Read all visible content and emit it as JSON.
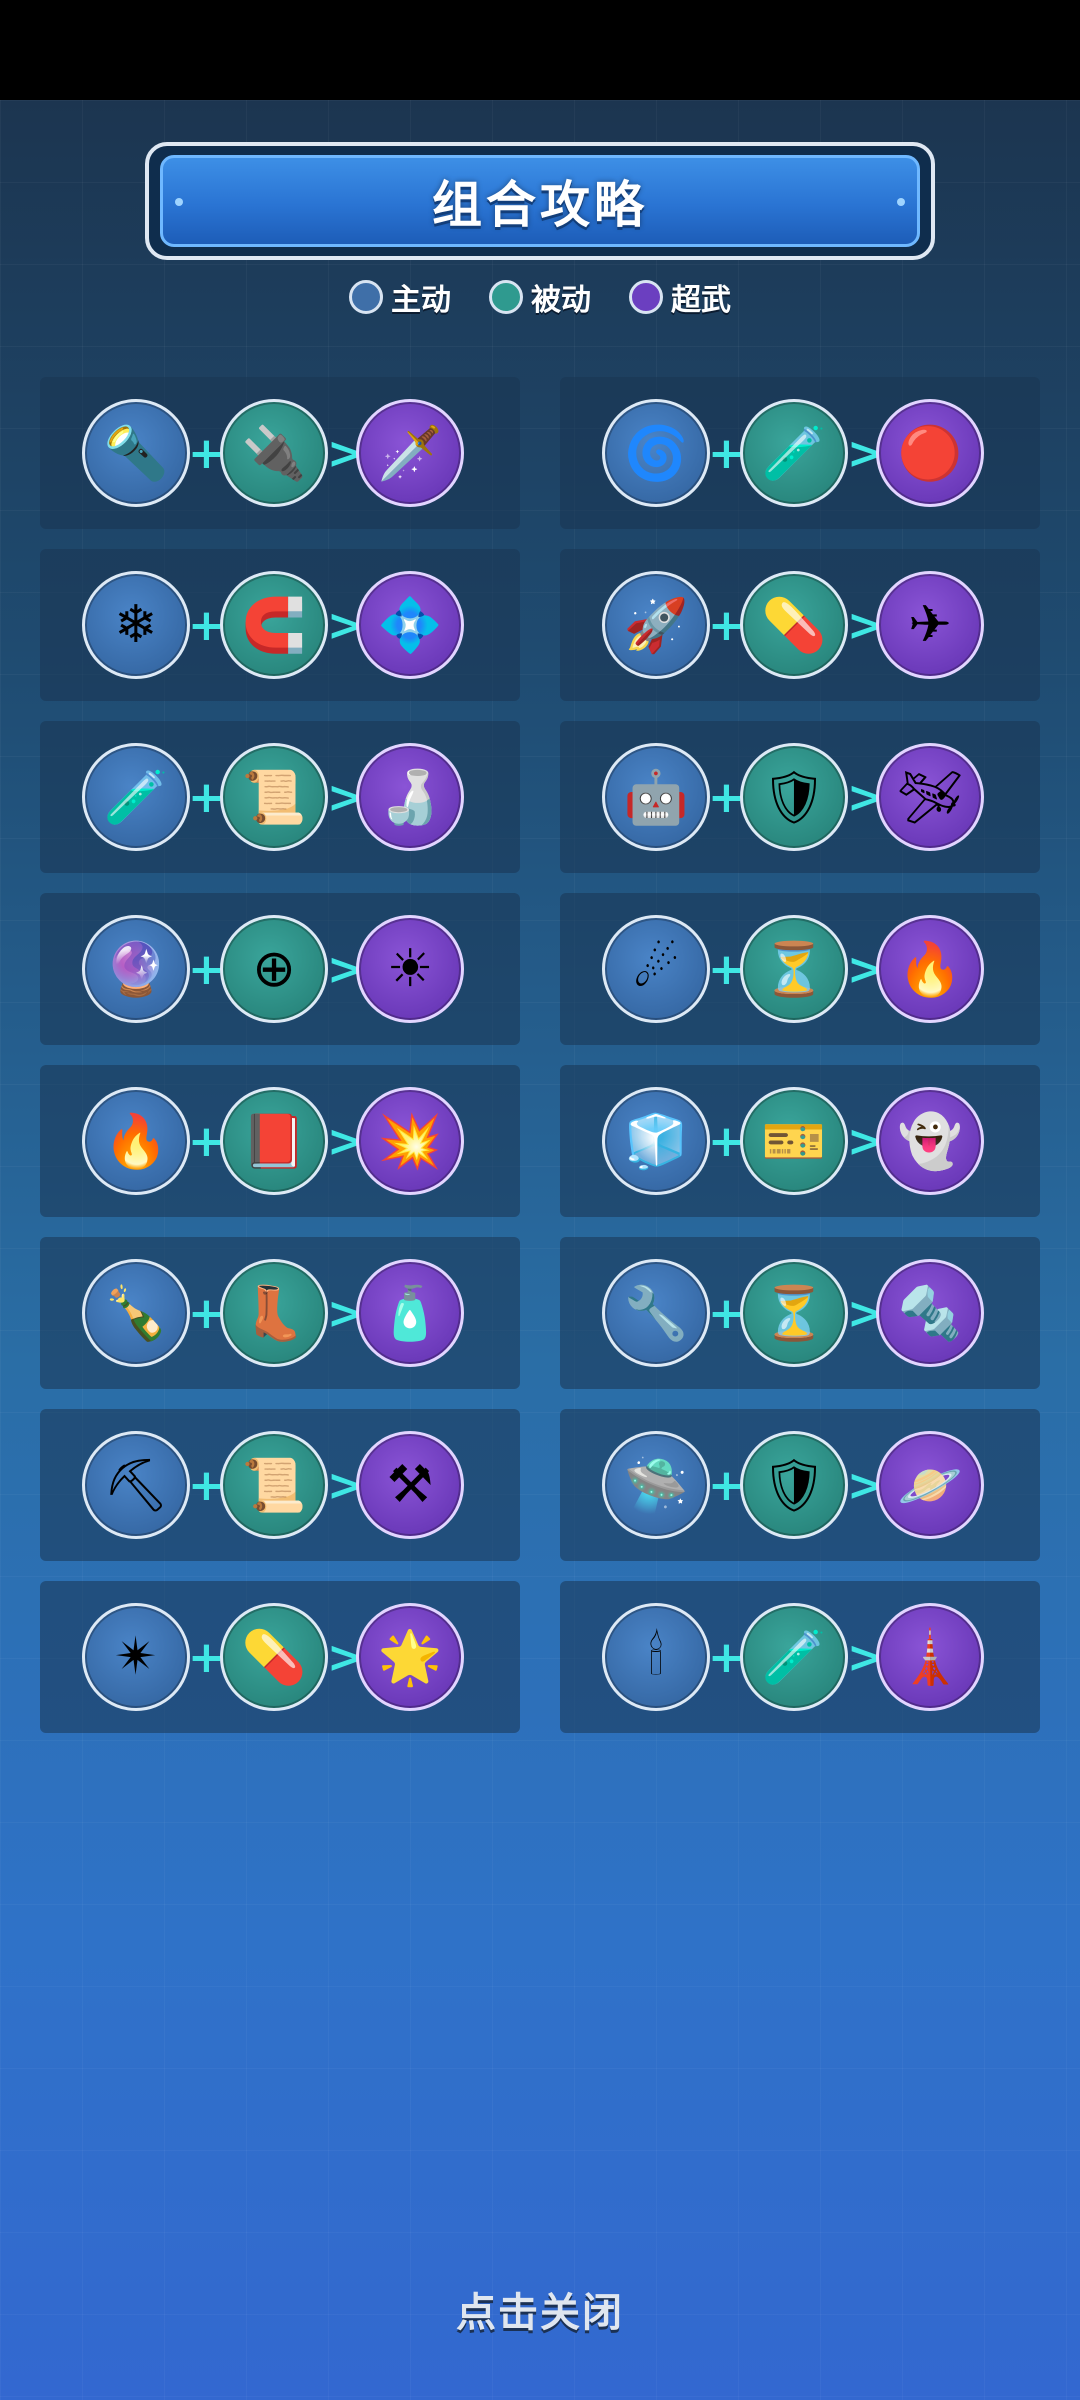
{
  "title": "组合攻略",
  "legend": {
    "active": {
      "label": "主动",
      "color": "#3f6fa8"
    },
    "passive": {
      "label": "被动",
      "color": "#2f9a8f"
    },
    "super": {
      "label": "超武",
      "color": "#6b3fc0"
    }
  },
  "combos": [
    {
      "a": "🔦",
      "b": "🔌",
      "r": "🗡️",
      "a_name": "lightsaber-blue-icon",
      "b_name": "power-generator-icon",
      "r_name": "lightsaber-pink-icon"
    },
    {
      "a": "🌀",
      "b": "🧪",
      "r": "🔴",
      "a_name": "purple-vortex-icon",
      "b_name": "red-potion-icon",
      "r_name": "red-vortex-icon"
    },
    {
      "a": "❄",
      "b": "🧲",
      "r": "💠",
      "a_name": "ice-shard-icon",
      "b_name": "magnet-icon",
      "r_name": "ice-crystal-icon"
    },
    {
      "a": "🚀",
      "b": "💊",
      "r": "✈",
      "a_name": "jet-fighter-icon",
      "b_name": "bullet-capsule-icon",
      "r_name": "jet-fighter-dark-icon"
    },
    {
      "a": "🧪",
      "b": "📜",
      "r": "🍶",
      "a_name": "blue-flask-icon",
      "b_name": "gold-scroll-icon",
      "r_name": "yellow-jar-icon"
    },
    {
      "a": "🤖",
      "b": "🛡",
      "r": "🛩",
      "a_name": "drone-icon",
      "b_name": "mech-armor-icon",
      "r_name": "mech-fighter-icon"
    },
    {
      "a": "🔮",
      "b": "⊕",
      "r": "☀",
      "a_name": "pink-orb-icon",
      "b_name": "crosshair-icon",
      "r_name": "sun-orb-icon"
    },
    {
      "a": "☄",
      "b": "⏳",
      "r": "🔥",
      "a_name": "meteor-icon",
      "b_name": "hourglass-icon",
      "r_name": "fire-meteor-icon"
    },
    {
      "a": "🔥",
      "b": "📕",
      "r": "💥",
      "a_name": "rocket-launcher-icon",
      "b_name": "red-book-icon",
      "r_name": "twin-rocket-icon"
    },
    {
      "a": "🧊",
      "b": "🎫",
      "r": "👻",
      "a_name": "ice-warrior-icon",
      "b_name": "exp-ticket-icon",
      "r_name": "ice-spirit-icon"
    },
    {
      "a": "🍾",
      "b": "👢",
      "r": "🧴",
      "a_name": "green-bottle-icon",
      "b_name": "boot-icon",
      "r_name": "purple-bottle-icon"
    },
    {
      "a": "🔧",
      "b": "⏳",
      "r": "🔩",
      "a_name": "pipe-cannon-icon",
      "b_name": "hourglass-icon",
      "r_name": "purple-pipe-icon"
    },
    {
      "a": "⛏",
      "b": "📜",
      "r": "⚒",
      "a_name": "scythe-icon",
      "b_name": "gold-scroll-icon",
      "r_name": "blue-scythe-icon"
    },
    {
      "a": "🛸",
      "b": "🛡",
      "r": "🪐",
      "a_name": "ufo-turret-icon",
      "b_name": "blue-shield-icon",
      "r_name": "red-ufo-icon"
    },
    {
      "a": "✴",
      "b": "💊",
      "r": "🌟",
      "a_name": "spiked-ball-icon",
      "b_name": "bullet-capsule-icon",
      "r_name": "gold-spiked-ball-icon"
    },
    {
      "a": "🕯",
      "b": "🧪",
      "r": "🗼",
      "a_name": "laser-tower-icon",
      "b_name": "red-potion-icon",
      "r_name": "gold-tower-icon"
    }
  ],
  "plus_symbol": "+",
  "arrow_symbol": ">",
  "close_label": "点击关闭"
}
